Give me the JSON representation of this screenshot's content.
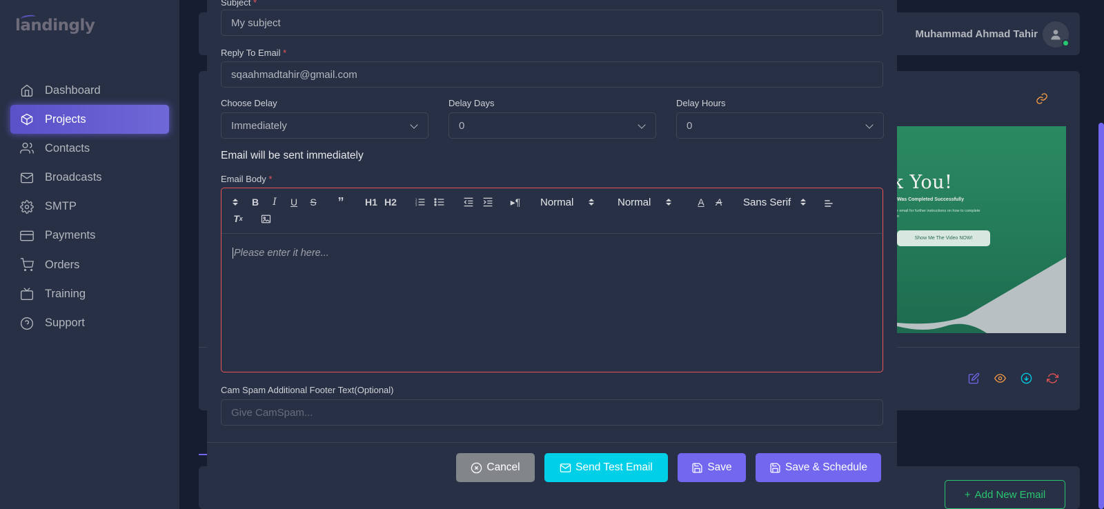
{
  "app": {
    "logo": "landingly",
    "user_name": "Muhammad Ahmad Tahir"
  },
  "sidebar": {
    "items": [
      {
        "label": "Dashboard",
        "icon": "home-icon"
      },
      {
        "label": "Projects",
        "icon": "box-icon",
        "active": true
      },
      {
        "label": "Contacts",
        "icon": "users-icon"
      },
      {
        "label": "Broadcasts",
        "icon": "mail-icon"
      },
      {
        "label": "SMTP",
        "icon": "gear-icon"
      },
      {
        "label": "Payments",
        "icon": "credit-card-icon"
      },
      {
        "label": "Orders",
        "icon": "cart-icon"
      },
      {
        "label": "Training",
        "icon": "tv-icon"
      },
      {
        "label": "Support",
        "icon": "help-circle-icon"
      }
    ]
  },
  "preview": {
    "title_fragment": "ank You!",
    "subtitle": "Was Completed Successfully",
    "small_text": "r email for further instructions on how to complete",
    "small_text2": "n",
    "button": "Show Me The Video NOW!"
  },
  "background": {
    "add_email_label": "Add New Email"
  },
  "form": {
    "subject": {
      "label": "Subject",
      "value": "My subject"
    },
    "reply_to": {
      "label": "Reply To Email",
      "value": "sqaahmadtahir@gmail.com"
    },
    "choose_delay": {
      "label": "Choose Delay",
      "value": "Immediately"
    },
    "delay_days": {
      "label": "Delay Days",
      "value": "0"
    },
    "delay_hours": {
      "label": "Delay Hours",
      "value": "0"
    },
    "notice": "Email will be sent immediately",
    "email_body": {
      "label": "Email Body",
      "placeholder": "Please enter it here...",
      "toolbar": {
        "h1": "H1",
        "h2": "H2",
        "header_select": "Normal",
        "size_select": "Normal",
        "font_select": "Sans Serif"
      }
    },
    "footer_text": {
      "label": "Cam Spam Additional Footer Text(Optional)",
      "placeholder": "Give CamSpam..."
    }
  },
  "buttons": {
    "cancel": "Cancel",
    "send_test": "Send Test Email",
    "save": "Save",
    "save_schedule": "Save & Schedule"
  },
  "colors": {
    "primary": "#7367f0",
    "info": "#00cfe8",
    "secondary": "#82868b",
    "danger": "#ea5455",
    "success": "#28c76f"
  }
}
